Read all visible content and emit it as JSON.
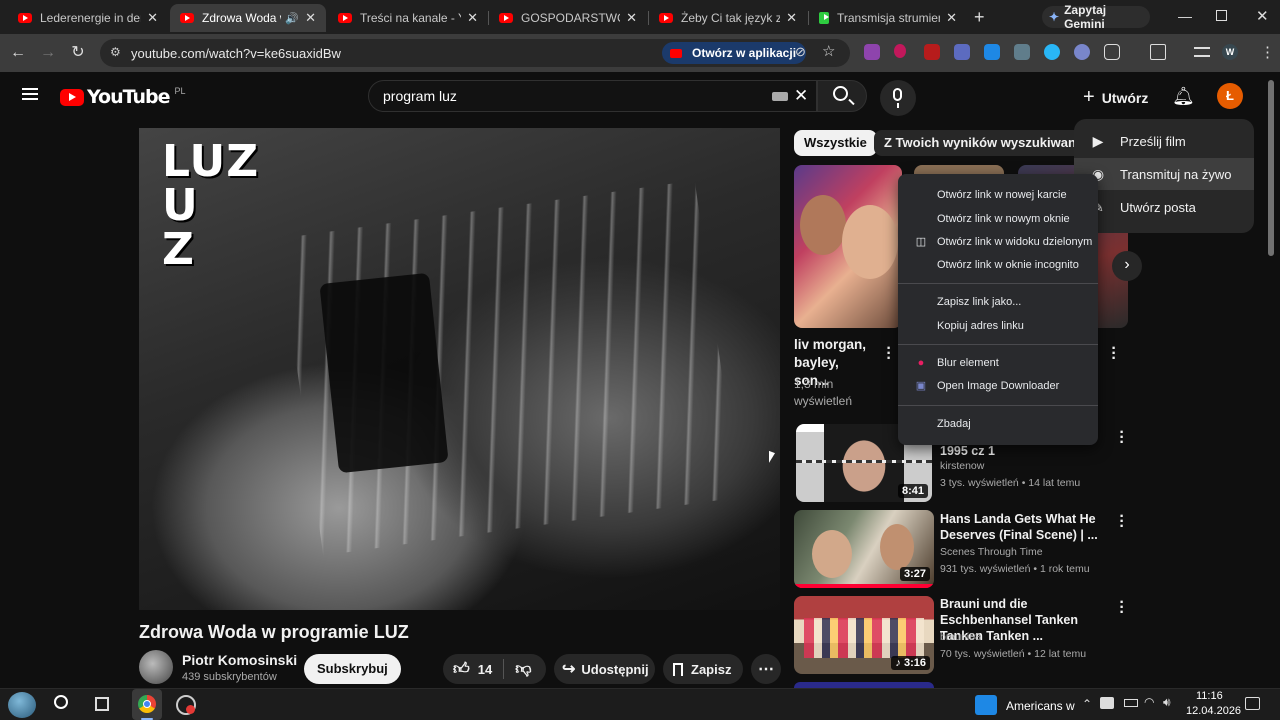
{
  "browser": {
    "tabs": [
      {
        "title": "Lederenergie in der W",
        "active": false,
        "icon": "youtube-icon"
      },
      {
        "title": "Zdrowa Woda w pr",
        "active": true,
        "icon": "youtube-icon",
        "audio": "speaker-icon"
      },
      {
        "title": "Treści na kanale - YouT",
        "active": false,
        "icon": "youtube-icon"
      },
      {
        "title": "GOSPODARSTWO Zakł",
        "active": false,
        "icon": "youtube-icon"
      },
      {
        "title": "Żeby Ci tak język zardz",
        "active": false,
        "icon": "youtube-icon"
      },
      {
        "title": "Transmisja strumieniow",
        "active": false,
        "icon": "kick-icon"
      }
    ],
    "new_tab": "+",
    "gemini_label": "Zapytaj Gemini",
    "url": "youtube.com/watch?v=ke6suaxidBw",
    "open_in_app": "Otwórz w aplikacji"
  },
  "youtube": {
    "logo_text": "YouTube",
    "logo_region": "PL",
    "search_query": "program luz",
    "create_label": "Utwórz",
    "avatar_letter": "Ł",
    "create_menu": [
      {
        "label": "Prześlij film",
        "icon": "upload-video-icon"
      },
      {
        "label": "Transmituj na żywo",
        "icon": "live-broadcast-icon"
      },
      {
        "label": "Utwórz posta",
        "icon": "edit-post-icon"
      }
    ]
  },
  "video": {
    "overlay_text": [
      "LUZ",
      "U",
      "Z"
    ],
    "title": "Zdrowa Woda w programie LUZ",
    "channel": "Piotr Komosinski",
    "subscribers": "439 subskrybentów",
    "subscribe_label": "Subskrybuj",
    "likes": "14",
    "share_label": "Udostępnij",
    "save_label": "Zapisz"
  },
  "filters": [
    "Wszystkie",
    "Z Twoich wyników wyszukiwania"
  ],
  "shorts": [
    {
      "title": "liv morgan, bayley, son...",
      "views": "1,3 mln",
      "views_label": "wyświetleń"
    }
  ],
  "recommended": [
    {
      "title": "1995 cz 1",
      "channel": "kirstenow",
      "meta": "3 tys. wyświetleń • 14 lat temu",
      "duration": "8:41"
    },
    {
      "title": "Hans Landa Gets What He Deserves (Final Scene) | ...",
      "channel": "Scenes Through Time",
      "meta": "931 tys. wyświetleń • 1 rok temu",
      "duration": "3:27"
    },
    {
      "title": "Brauni und die Eschbenhansel Tanken Tanken Tanken ...",
      "channel": "brauni68",
      "meta": "70 tys. wyświetleń • 12 lat temu",
      "duration": "3:16"
    }
  ],
  "context_menu": {
    "group1": [
      {
        "label": "Otwórz link w nowej karcie",
        "icon": ""
      },
      {
        "label": "Otwórz link w nowym oknie",
        "icon": ""
      },
      {
        "label": "Otwórz link w widoku dzielonym",
        "icon": "split-view-icon"
      },
      {
        "label": "Otwórz link w oknie incognito",
        "icon": ""
      }
    ],
    "group2": [
      {
        "label": "Zapisz link jako...",
        "icon": ""
      },
      {
        "label": "Kopiuj adres linku",
        "icon": ""
      }
    ],
    "group3": [
      {
        "label": "Blur element",
        "icon": "blur-extension-icon"
      },
      {
        "label": "Open Image Downloader",
        "icon": "image-downloader-icon"
      }
    ],
    "group4": [
      {
        "label": "Zbadaj",
        "icon": ""
      }
    ]
  },
  "taskbar": {
    "news": "Americans w",
    "time": "11:16",
    "date": "12.04.2026"
  },
  "colors": {
    "youtube_red": "#ff0000",
    "accent_orange": "#e65c00",
    "chip_active": "#f1f1f1"
  }
}
